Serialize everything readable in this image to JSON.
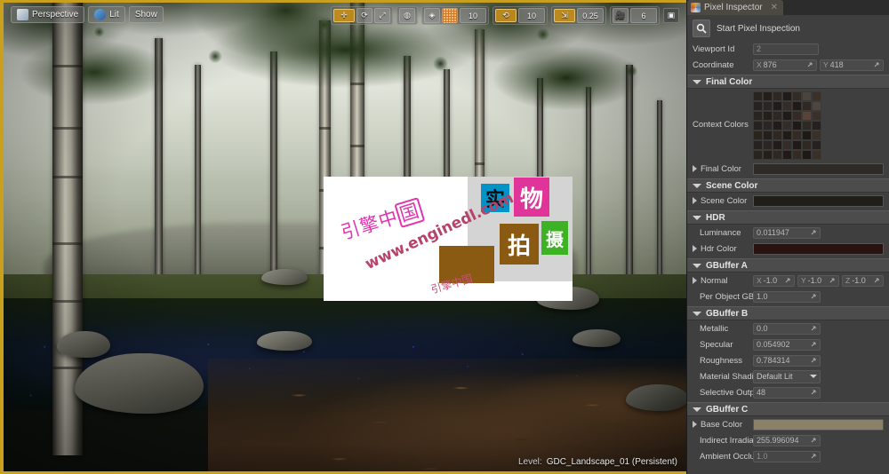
{
  "viewport": {
    "toolbar_left": [
      {
        "label": "Perspective",
        "icon": "perspective-camera-icon"
      },
      {
        "label": "Lit",
        "icon": "lit-sphere-icon"
      },
      {
        "label": "Show",
        "icon": "show-menu-icon"
      }
    ],
    "toolbar_right": {
      "transform_tools": [
        {
          "name": "select-translate-tool",
          "icon": "move-arrows-icon",
          "active": true
        },
        {
          "name": "rotate-tool",
          "icon": "rotate-gizmo-icon",
          "active": false
        },
        {
          "name": "scale-tool",
          "icon": "scale-gizmo-icon",
          "active": false
        }
      ],
      "coordinate_system": {
        "name": "world-local-toggle",
        "icon": "globe-icon"
      },
      "surface_snap": {
        "name": "surface-snap-toggle",
        "icon": "surface-snap-icon"
      },
      "grid_snap": {
        "name": "grid-snap-toggle",
        "icon": "grid-icon",
        "active": true,
        "value": "10"
      },
      "rotation_snap": {
        "name": "rotation-snap-toggle",
        "icon": "rotation-snap-icon",
        "active": true,
        "value": "10"
      },
      "scale_snap": {
        "name": "scale-snap-toggle",
        "icon": "scale-snap-icon",
        "active": true,
        "value": "0.25"
      },
      "camera_speed": {
        "name": "camera-speed",
        "icon": "camera-icon",
        "value": "6"
      },
      "maximize": {
        "name": "maximize-viewport-toggle",
        "icon": "maximize-icon"
      }
    },
    "status": {
      "level_label": "Level:",
      "level_name": "GDC_Landscape_01 (Persistent)"
    }
  },
  "watermark": {
    "logo_prefix": "引擎",
    "logo_mid": "中",
    "logo_boxed": "国",
    "url": "www.enginedl.com",
    "sub": "引擎中国",
    "blocks": [
      {
        "char": "实",
        "color": "#0093c8"
      },
      {
        "char": "物",
        "color": "#e0349a"
      },
      {
        "char": "拍",
        "color": "#8a5a13"
      },
      {
        "char": "摄",
        "color": "#3cb224"
      }
    ]
  },
  "panel": {
    "tab": {
      "title": "Pixel Inspector",
      "close": "✕",
      "icon": "pixel-inspector-icon"
    },
    "start_button": {
      "label": "Start Pixel Inspection",
      "icon": "magnifier-icon"
    },
    "viewport_id": {
      "label": "Viewport Id",
      "value": "2"
    },
    "coordinate": {
      "label": "Coordinate",
      "x_axis": "X",
      "x_value": "876",
      "y_axis": "Y",
      "y_value": "418"
    },
    "sections": [
      {
        "name": "Final Color",
        "rows": [
          {
            "label": "Context Colors",
            "type": "swatch-grid",
            "cols": 7,
            "rows": 7
          },
          {
            "label": "Final Color",
            "type": "color",
            "value": "#2e2a25",
            "expandable": true
          }
        ]
      },
      {
        "name": "Scene Color",
        "rows": [
          {
            "label": "Scene Color",
            "type": "color",
            "value": "#211d18",
            "expandable": true
          }
        ]
      },
      {
        "name": "HDR",
        "rows": [
          {
            "label": "Luminance",
            "type": "number",
            "value": "0.011947"
          },
          {
            "label": "Hdr Color",
            "type": "color",
            "value": "#2a1210",
            "expandable": true
          }
        ]
      },
      {
        "name": "GBuffer A",
        "rows": [
          {
            "label": "Normal",
            "type": "vector3",
            "x": "-1.0",
            "y": "-1.0",
            "z": "-1.0",
            "expandable": true
          },
          {
            "label": "Per Object GBuffe",
            "type": "number",
            "value": "1.0"
          }
        ]
      },
      {
        "name": "GBuffer B",
        "rows": [
          {
            "label": "Metallic",
            "type": "number",
            "value": "0.0"
          },
          {
            "label": "Specular",
            "type": "number",
            "value": "0.054902"
          },
          {
            "label": "Roughness",
            "type": "number",
            "value": "0.784314"
          },
          {
            "label": "Material Shading",
            "type": "select",
            "value": "Default Lit"
          },
          {
            "label": "Selective Output I",
            "type": "number",
            "value": "48"
          }
        ]
      },
      {
        "name": "GBuffer C",
        "rows": [
          {
            "label": "Base Color",
            "type": "color",
            "value": "#8a8168",
            "expandable": true
          },
          {
            "label": "Indirect Irradiance",
            "type": "number",
            "value": "255.996094"
          },
          {
            "label": "Ambient Occlusio",
            "type": "number",
            "value": "1.0",
            "dim": true
          }
        ]
      }
    ]
  },
  "colors": {
    "accent_viewport_border": "#c8a01e",
    "panel_bg": "#3f3f3f",
    "section_bg": "#4c4c4c",
    "input_bg": "#4a4a4a"
  }
}
